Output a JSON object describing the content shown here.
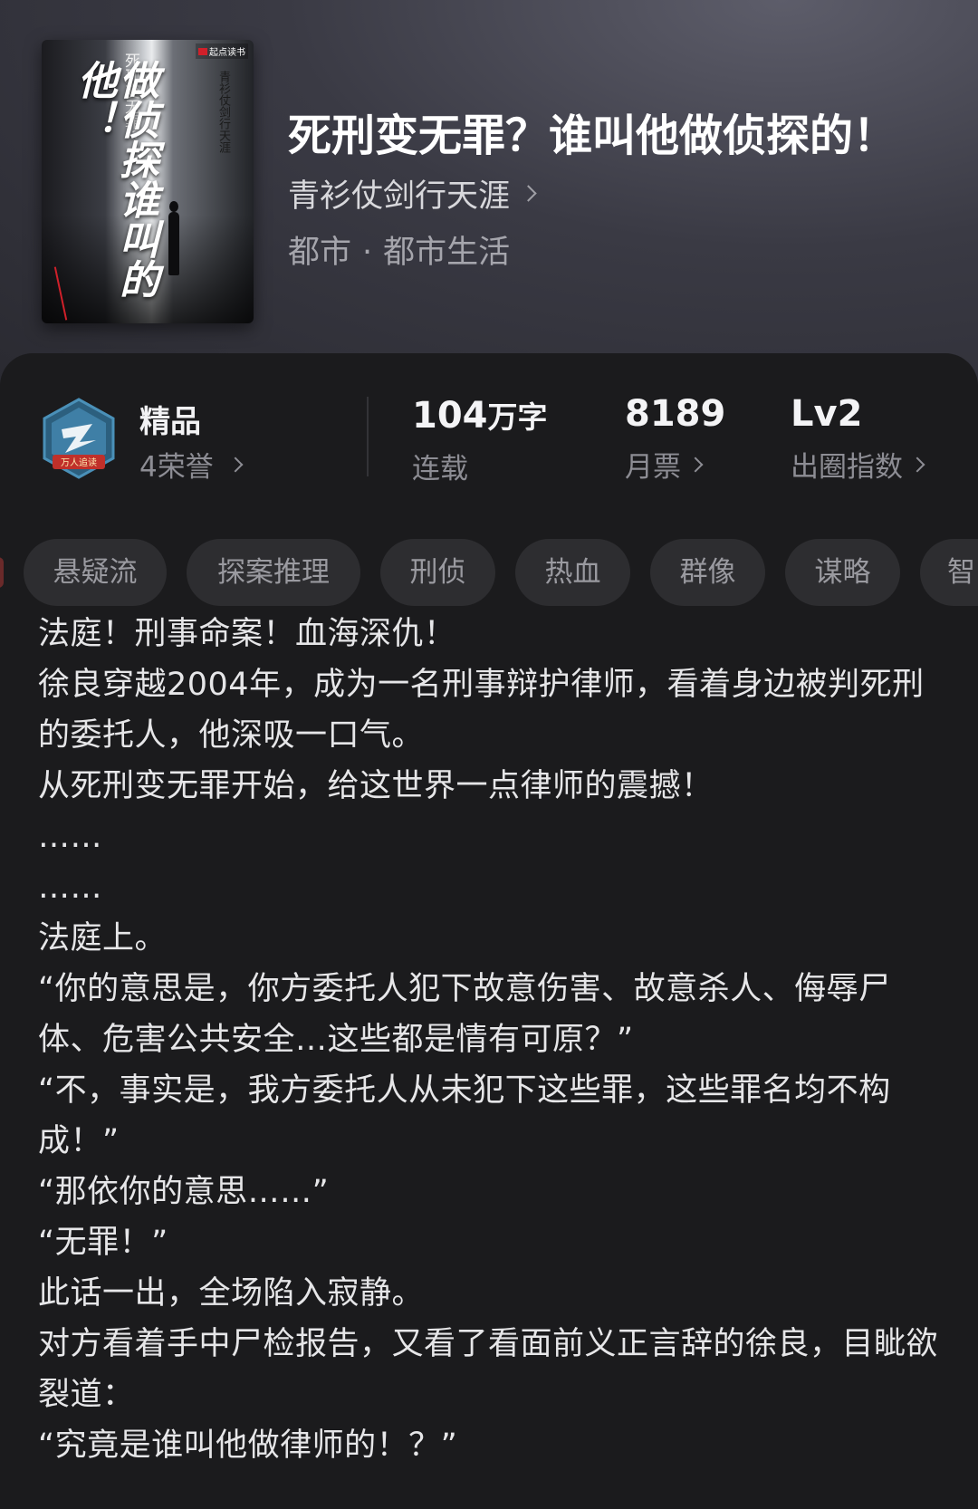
{
  "book": {
    "title": "死刑变无罪？谁叫他做侦探的！",
    "author": "青衫仗剑行天涯",
    "genre_main": "都市",
    "genre_separator": "·",
    "genre_sub": "都市生活"
  },
  "cover": {
    "title_text": "做侦探谁叫的他！",
    "subtitle_text": "死刑变无罪？",
    "author_text": "青衫仗剑行天涯",
    "brand_text": "起点读书"
  },
  "honor": {
    "name": "精品",
    "count": "4荣誉",
    "badge_label": "万人追读",
    "badge_color": "#3f7fa6"
  },
  "stats": [
    {
      "value": "104",
      "unit": "万字",
      "label": "连载",
      "has_chevron": false
    },
    {
      "value": "8189",
      "unit": "",
      "label": "月票",
      "has_chevron": true
    },
    {
      "value": "Lv2",
      "unit": "",
      "label": "出圈指数",
      "has_chevron": true
    }
  ],
  "tags": [
    "悬疑流",
    "探案推理",
    "刑侦",
    "热血",
    "群像",
    "谋略",
    "智"
  ],
  "synopsis": [
    "法庭！刑事命案！血海深仇！",
    "徐良穿越2004年，成为一名刑事辩护律师，看着身边被判死刑的委托人，他深吸一口气。",
    "从死刑变无罪开始，给这世界一点律师的震撼！",
    "……",
    "……",
    "法庭上。",
    "“你的意思是，你方委托人犯下故意伤害、故意杀人、侮辱尸体、危害公共安全…这些都是情有可原？”",
    "“不，事实是，我方委托人从未犯下这些罪，这些罪名均不构成！”",
    "“那依你的意思……”",
    "“无罪！”",
    "此话一出，全场陷入寂静。",
    "对方看着手中尸检报告，又看了看面前义正言辞的徐良，目眦欲裂道：",
    "“究竟是谁叫他做律师的！？”"
  ],
  "colors": {
    "background": "#1b1b1d",
    "tag_background": "#2d2d30",
    "muted_text": "#8d8d94"
  }
}
